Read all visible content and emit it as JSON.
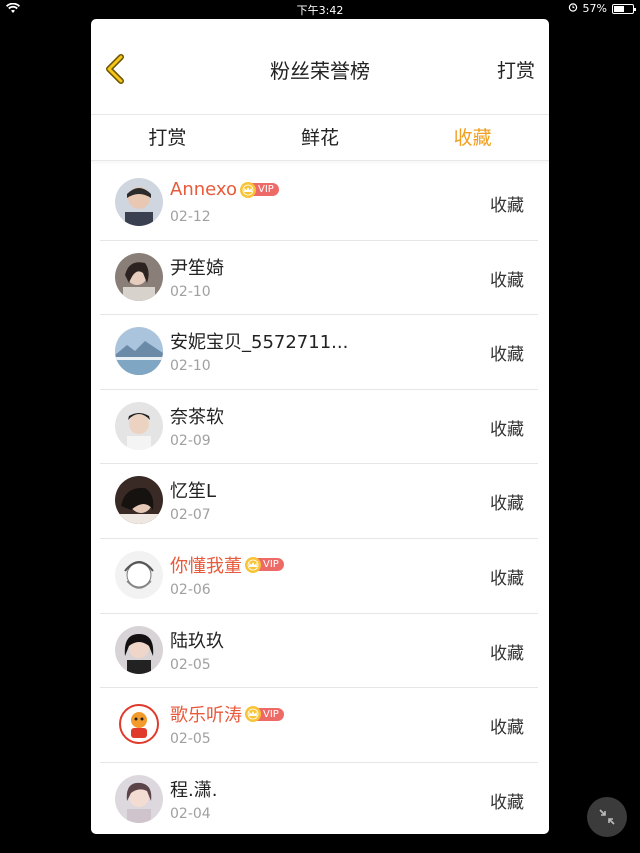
{
  "status_bar": {
    "time": "下午3:42",
    "battery": "57%",
    "battery_level": 0.57
  },
  "header": {
    "title": "粉丝荣誉榜",
    "right_action": "打赏"
  },
  "tabs": [
    {
      "label": "打赏",
      "active": false
    },
    {
      "label": "鲜花",
      "active": false
    },
    {
      "label": "收藏",
      "active": true
    }
  ],
  "vip_badge_text": "VIP",
  "fans": [
    {
      "name": "Annexo",
      "date": "02-12",
      "vip": true,
      "action": "收藏"
    },
    {
      "name": "尹笙婍",
      "date": "02-10",
      "vip": false,
      "action": "收藏"
    },
    {
      "name": "安妮宝贝_5572711...",
      "date": "02-10",
      "vip": false,
      "action": "收藏"
    },
    {
      "name": "奈茶软",
      "date": "02-09",
      "vip": false,
      "action": "收藏"
    },
    {
      "name": "忆笙L",
      "date": "02-07",
      "vip": false,
      "action": "收藏"
    },
    {
      "name": "你懂我董",
      "date": "02-06",
      "vip": true,
      "action": "收藏"
    },
    {
      "name": "陆玖玖",
      "date": "02-05",
      "vip": false,
      "action": "收藏"
    },
    {
      "name": "歌乐听涛",
      "date": "02-05",
      "vip": true,
      "action": "收藏"
    },
    {
      "name": "程.潇.",
      "date": "02-04",
      "vip": false,
      "action": "收藏"
    }
  ],
  "colors": {
    "accent": "#f0a020",
    "vip_name": "#e85a3c",
    "vip_badge": "#ee6a66",
    "crown": "#f7c437"
  }
}
